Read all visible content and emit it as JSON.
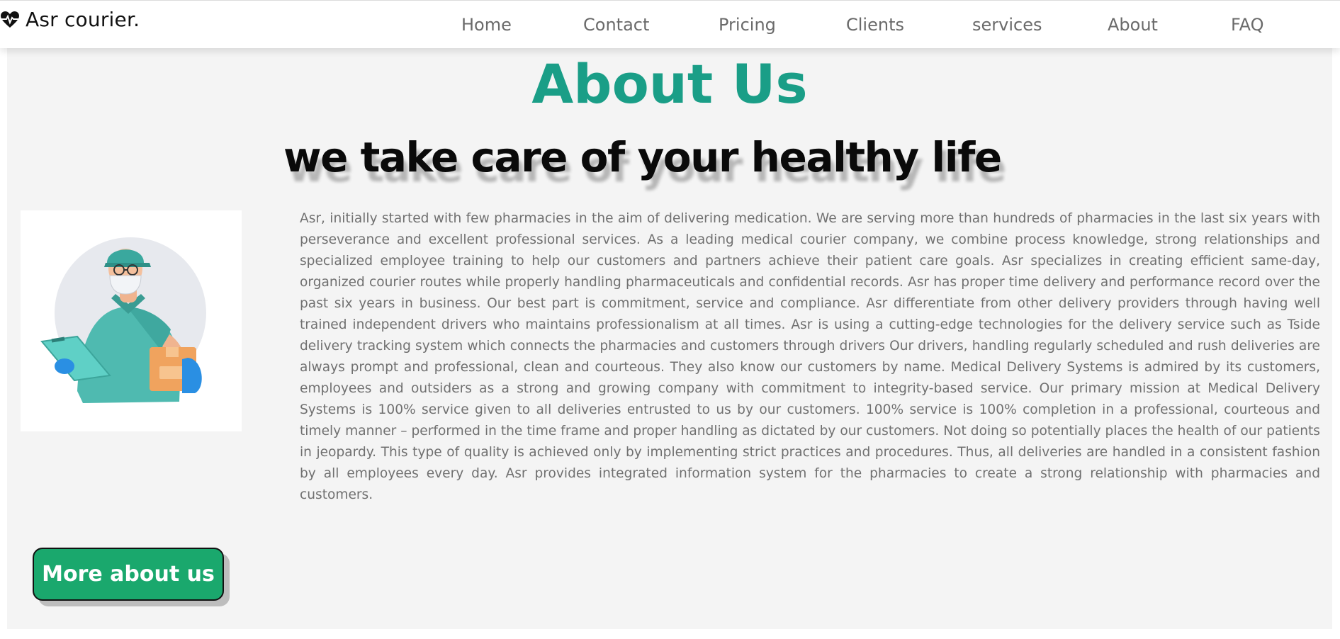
{
  "brand": {
    "name": "Asr courier.",
    "icon": "heartbeat-icon"
  },
  "nav": {
    "items": [
      {
        "label": "Home"
      },
      {
        "label": "Contact"
      },
      {
        "label": "Pricing"
      },
      {
        "label": "Clients"
      },
      {
        "label": "services"
      },
      {
        "label": "About"
      },
      {
        "label": "FAQ"
      }
    ]
  },
  "about": {
    "title": "About Us",
    "tagline": "we take care of your healthy life",
    "body": "Asr, initially started with few pharmacies in the aim of delivering medication. We are serving more than hundreds of pharmacies in the last six years with perseverance and excellent professional services. As a leading medical courier company, we combine process knowledge, strong relationships and specialized employee training to help our customers and partners achieve their patient care goals. Asr specializes in creating efficient same-day, organized courier routes while properly handling pharmaceuticals and confidential records. Asr has proper time delivery and performance record over the past six years in business. Our best part is commitment, service and compliance. Asr differentiate from other delivery providers through having well trained independent drivers who maintains professionalism at all times. Asr is using a cutting-edge technologies for the delivery service such as Tside delivery tracking system which connects the pharmacies and customers through drivers Our drivers, handling regularly scheduled and rush deliveries are always prompt and professional, clean and courteous. They also know our customers by name. Medical Delivery Systems is admired by its customers, employees and outsiders as a strong and growing company with commitment to integrity-based service. Our primary mission at Medical Delivery Systems is 100% service given to all deliveries entrusted to us by our customers. 100% service is 100% completion in a professional, courteous and timely manner – performed in the time frame and proper handling as dictated by our customers. Not doing so potentially places the health of our patients in jeopardy. This type of quality is achieved only by implementing strict practices and procedures. Thus, all deliveries are handled in a consistent fashion by all employees every day. Asr provides integrated information system for the pharmacies to create a strong relationship with pharmacies and customers.",
    "button_label": "More about us"
  },
  "colors": {
    "accent_title": "#1a9e87",
    "button_bg": "#1aa86d",
    "body_text": "#707070",
    "section_bg": "#f4f4f4"
  }
}
